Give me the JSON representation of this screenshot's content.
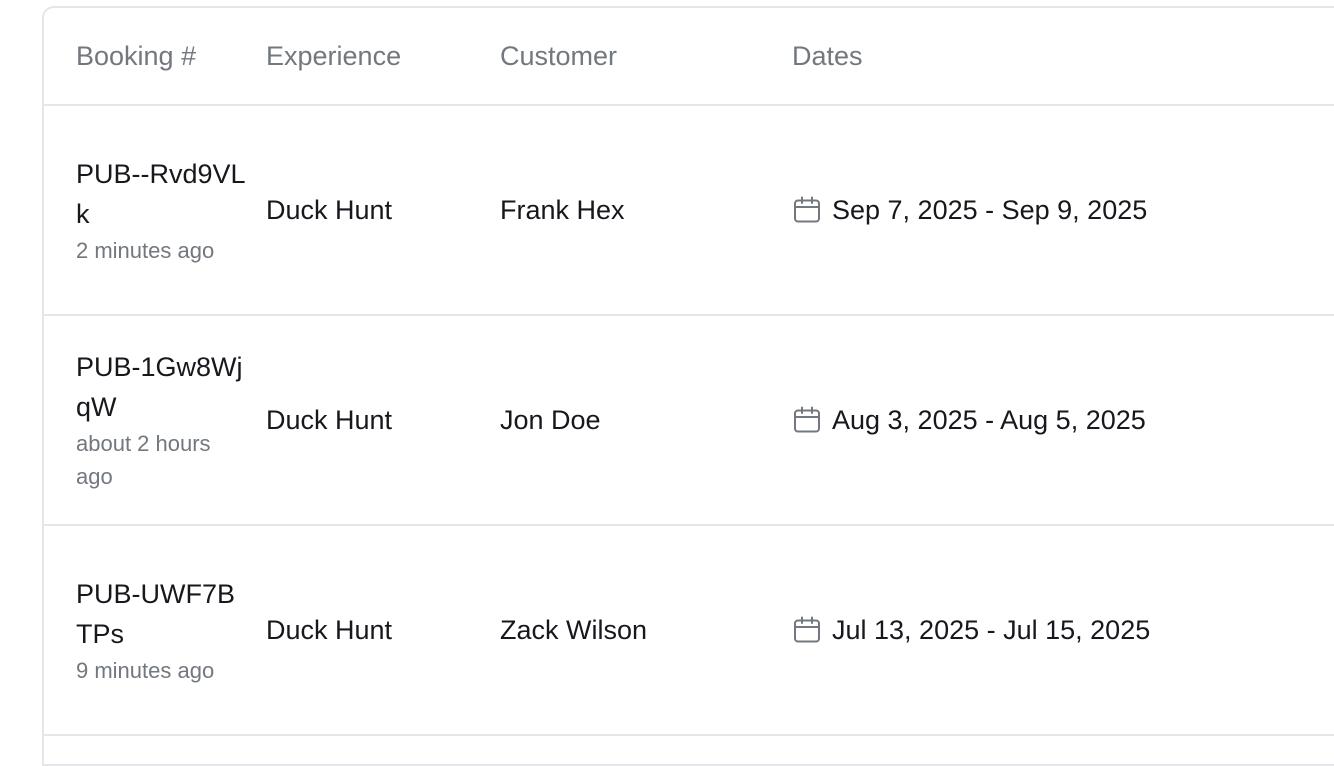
{
  "table": {
    "columns": {
      "booking": "Booking #",
      "experience": "Experience",
      "customer": "Customer",
      "dates": "Dates"
    },
    "rows": [
      {
        "booking_id": "PUB--Rvd9VLk",
        "created_ago": "2 minutes ago",
        "experience": "Duck Hunt",
        "customer": "Frank Hex",
        "dates": "Sep 7, 2025 - Sep 9, 2025",
        "date_icon": "calendar-icon"
      },
      {
        "booking_id": "PUB-1Gw8WjqW",
        "created_ago": "about 2 hours ago",
        "experience": "Duck Hunt",
        "customer": "Jon Doe",
        "dates": "Aug 3, 2025 - Aug 5, 2025",
        "date_icon": "calendar-icon"
      },
      {
        "booking_id": "PUB-UWF7BTPs",
        "created_ago": "9 minutes ago",
        "experience": "Duck Hunt",
        "customer": "Zack Wilson",
        "dates": "Jul 13, 2025 - Jul 15, 2025",
        "date_icon": "calendar-icon"
      }
    ]
  },
  "colors": {
    "border": "#e4e6e9",
    "muted_text": "#72787e",
    "text": "#16181d"
  }
}
